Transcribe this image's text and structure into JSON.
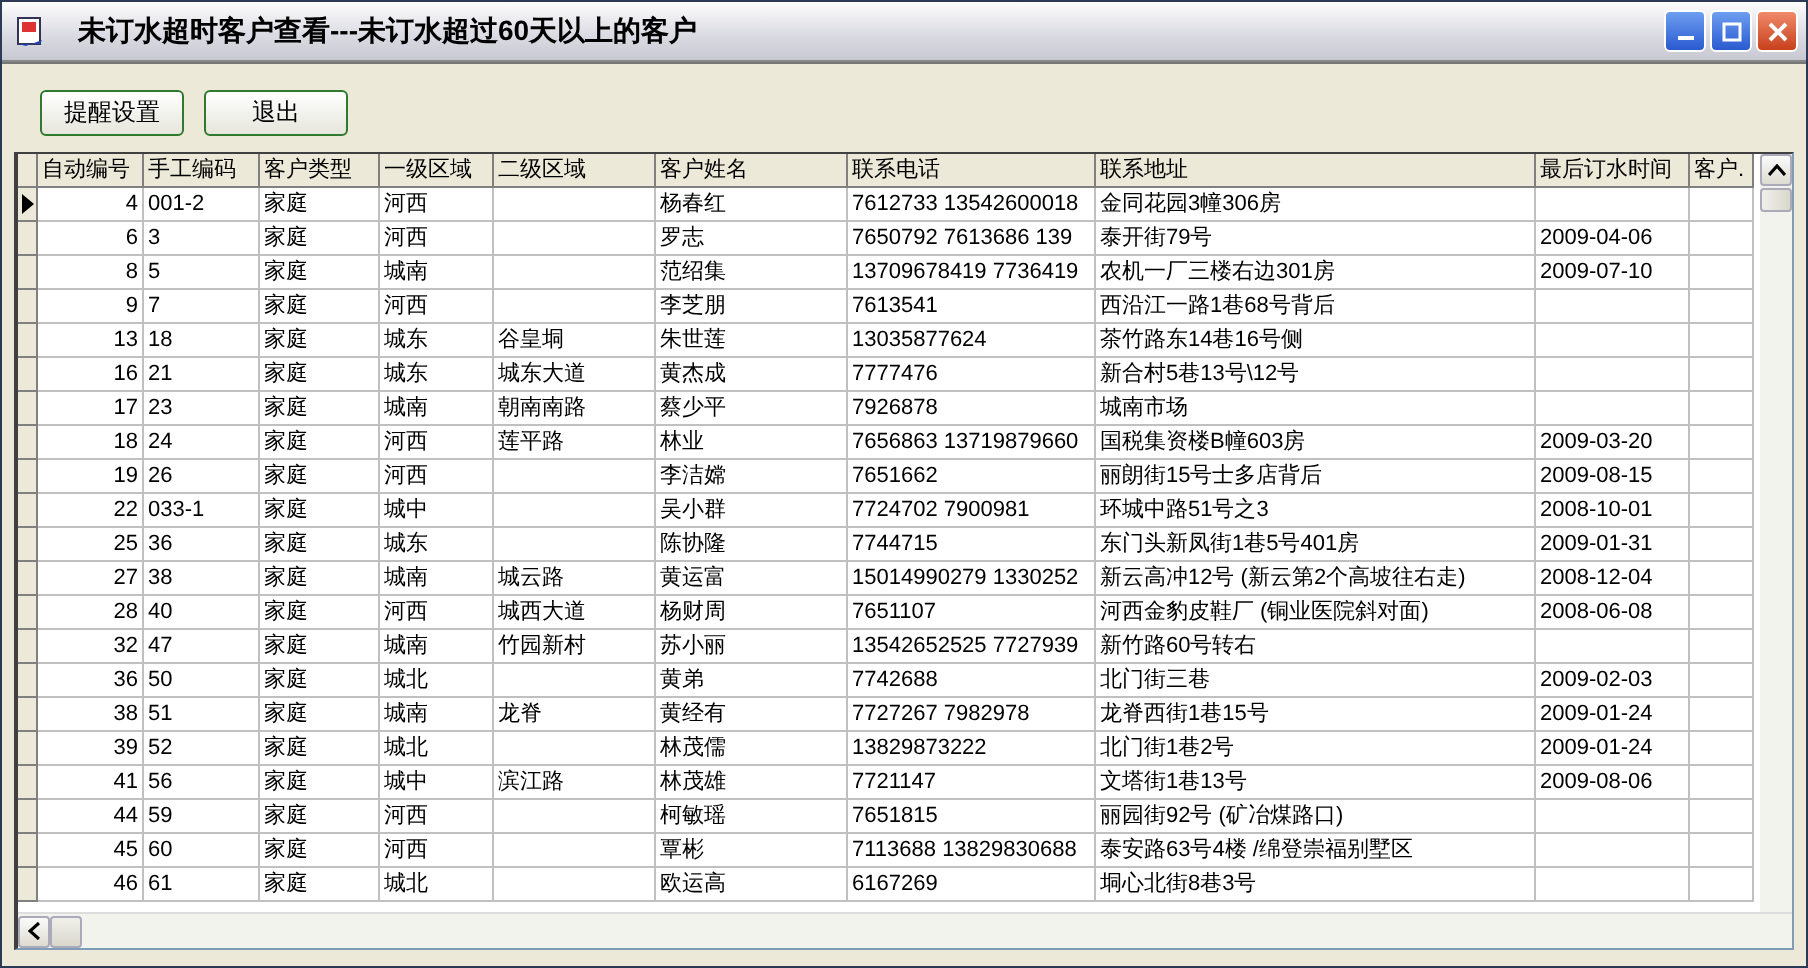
{
  "window": {
    "title": "未订水超时客户查看---未订水超过60天以上的客户"
  },
  "toolbar": {
    "buttons": [
      "提醒设置",
      "退出"
    ]
  },
  "table": {
    "columns": [
      "自动编号",
      "手工编码",
      "客户类型",
      "一级区域",
      "二级区域",
      "客户姓名",
      "联系电话",
      "联系地址",
      "最后订水时间",
      "客户."
    ],
    "rows": [
      {
        "current": true,
        "auto_no": "4",
        "manual_code": "001-2",
        "type": "家庭",
        "region1": "河西",
        "name": "杨春红",
        "phone": "7612733 13542600018",
        "address": "金同花园3幢306房"
      },
      {
        "current": false,
        "auto_no": "6",
        "manual_code": "3",
        "type": "家庭",
        "region1": "河西",
        "name": "罗志",
        "phone": "7650792 7613686 139",
        "address": "泰开街79号",
        "last_order": "2009-04-06"
      },
      {
        "current": false,
        "auto_no": "8",
        "manual_code": "5",
        "type": "家庭",
        "region1": "城南",
        "name": "范绍集",
        "phone": "13709678419 7736419",
        "address": "农机一厂三楼右边301房",
        "last_order": "2009-07-10"
      },
      {
        "current": false,
        "auto_no": "9",
        "manual_code": "7",
        "type": "家庭",
        "region1": "河西",
        "name": "李芝朋",
        "phone": "7613541",
        "address": "西沿江一路1巷68号背后"
      },
      {
        "current": false,
        "auto_no": "13",
        "manual_code": "18",
        "type": "家庭",
        "region1": "城东",
        "region2": "谷皇垌",
        "name": "朱世莲",
        "phone": "13035877624",
        "address": "茶竹路东14巷16号侧"
      },
      {
        "current": false,
        "auto_no": "16",
        "manual_code": "21",
        "type": "家庭",
        "region1": "城东",
        "region2": "城东大道",
        "name": "黄杰成",
        "phone": "7777476",
        "address": "新合村5巷13号\\12号"
      },
      {
        "current": false,
        "auto_no": "17",
        "manual_code": "23",
        "type": "家庭",
        "region1": "城南",
        "region2": "朝南南路",
        "name": "蔡少平",
        "phone": "7926878",
        "address": "城南市场"
      },
      {
        "current": false,
        "auto_no": "18",
        "manual_code": "24",
        "type": "家庭",
        "region1": "河西",
        "region2": "莲平路",
        "name": "林业",
        "phone": "7656863 13719879660",
        "address": "国税集资楼B幢603房",
        "last_order": "2009-03-20"
      },
      {
        "current": false,
        "auto_no": "19",
        "manual_code": "26",
        "type": "家庭",
        "region1": "河西",
        "name": "李洁嫦",
        "phone": "7651662",
        "address": "丽朗街15号士多店背后",
        "last_order": "2009-08-15"
      },
      {
        "current": false,
        "auto_no": "22",
        "manual_code": "033-1",
        "type": "家庭",
        "region1": "城中",
        "name": "吴小群",
        "phone": "7724702 7900981",
        "address": "环城中路51号之3",
        "last_order": "2008-10-01"
      },
      {
        "current": false,
        "auto_no": "25",
        "manual_code": "36",
        "type": "家庭",
        "region1": "城东",
        "name": "陈协隆",
        "phone": "7744715",
        "address": "东门头新凤街1巷5号401房",
        "last_order": "2009-01-31"
      },
      {
        "current": false,
        "auto_no": "27",
        "manual_code": "38",
        "type": "家庭",
        "region1": "城南",
        "region2": "城云路",
        "name": "黄运富",
        "phone": "15014990279 1330252",
        "address": "新云高冲12号 (新云第2个高坡往右走)",
        "last_order": "2008-12-04"
      },
      {
        "current": false,
        "auto_no": "28",
        "manual_code": "40",
        "type": "家庭",
        "region1": "河西",
        "region2": "城西大道",
        "name": "杨财周",
        "phone": "7651107",
        "address": "河西金豹皮鞋厂 (铜业医院斜对面)",
        "last_order": "2008-06-08"
      },
      {
        "current": false,
        "auto_no": "32",
        "manual_code": "47",
        "type": "家庭",
        "region1": "城南",
        "region2": "竹园新村",
        "name": "苏小丽",
        "phone": "13542652525 7727939",
        "address": "新竹路60号转右"
      },
      {
        "current": false,
        "auto_no": "36",
        "manual_code": "50",
        "type": "家庭",
        "region1": "城北",
        "name": "黄弟",
        "phone": "7742688",
        "address": "北门街三巷",
        "last_order": "2009-02-03"
      },
      {
        "current": false,
        "auto_no": "38",
        "manual_code": "51",
        "type": "家庭",
        "region1": "城南",
        "region2": "龙脊",
        "name": "黄经有",
        "phone": "7727267 7982978",
        "address": "龙脊西街1巷15号",
        "last_order": "2009-01-24"
      },
      {
        "current": false,
        "auto_no": "39",
        "manual_code": "52",
        "type": "家庭",
        "region1": "城北",
        "name": "林茂儒",
        "phone": "13829873222",
        "address": "北门街1巷2号",
        "last_order": "2009-01-24"
      },
      {
        "current": false,
        "auto_no": "41",
        "manual_code": "56",
        "type": "家庭",
        "region1": "城中",
        "region2": "滨江路",
        "name": "林茂雄",
        "phone": "7721147",
        "address": "文塔街1巷13号",
        "last_order": "2009-08-06"
      },
      {
        "current": false,
        "auto_no": "44",
        "manual_code": "59",
        "type": "家庭",
        "region1": "河西",
        "name": "柯敏瑶",
        "phone": "7651815",
        "address": "丽园街92号 (矿冶煤路口)"
      },
      {
        "current": false,
        "auto_no": "45",
        "manual_code": "60",
        "type": "家庭",
        "region1": "河西",
        "name": "覃彬",
        "phone": "7113688 13829830688",
        "address": "泰安路63号4楼 /绵登崇福别墅区"
      },
      {
        "current": false,
        "auto_no": "46",
        "manual_code": "61",
        "type": "家庭",
        "region1": "城北",
        "name": "欧运高",
        "phone": "6167269",
        "address": "垌心北街8巷3号"
      }
    ]
  }
}
